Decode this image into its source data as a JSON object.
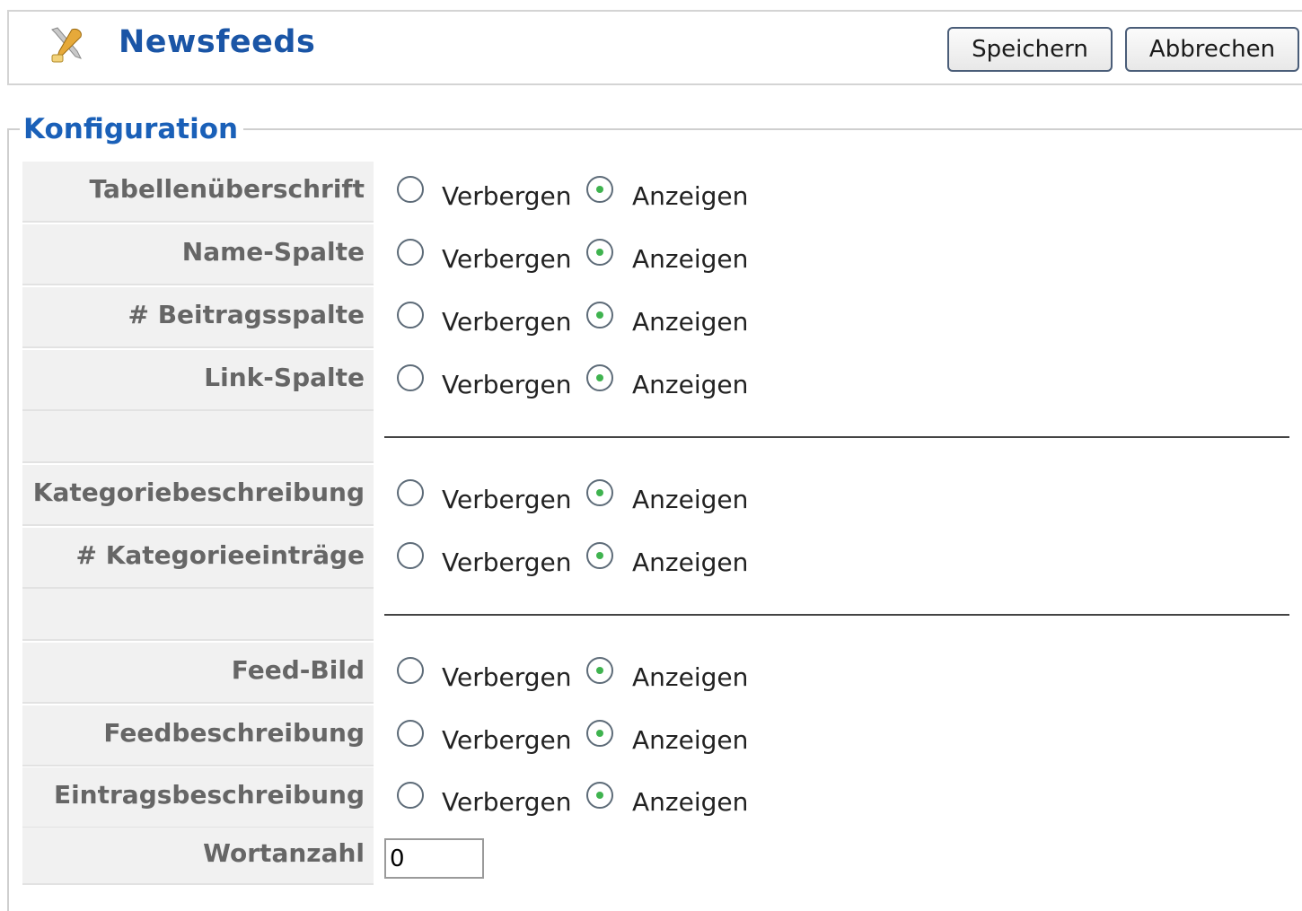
{
  "header": {
    "title": "Newsfeeds",
    "icon": "config-tools-icon",
    "save_label": "Speichern",
    "cancel_label": "Abbrechen"
  },
  "config": {
    "legend": "Konfiguration",
    "rows": [
      {
        "label": "Tabellenüberschrift",
        "options": [
          "Verbergen",
          "Anzeigen"
        ],
        "selected": "Anzeigen"
      },
      {
        "label": "Name-Spalte",
        "options": [
          "Verbergen",
          "Anzeigen"
        ],
        "selected": "Anzeigen"
      },
      {
        "label": "# Beitragsspalte",
        "options": [
          "Verbergen",
          "Anzeigen"
        ],
        "selected": "Anzeigen"
      },
      {
        "label": "Link-Spalte",
        "options": [
          "Verbergen",
          "Anzeigen"
        ],
        "selected": "Anzeigen"
      },
      {
        "label": "Kategoriebeschreibung",
        "options": [
          "Verbergen",
          "Anzeigen"
        ],
        "selected": "Anzeigen"
      },
      {
        "label": "# Kategorieeinträge",
        "options": [
          "Verbergen",
          "Anzeigen"
        ],
        "selected": "Anzeigen"
      },
      {
        "label": "Feed-Bild",
        "options": [
          "Verbergen",
          "Anzeigen"
        ],
        "selected": "Anzeigen"
      },
      {
        "label": "Feedbeschreibung",
        "options": [
          "Verbergen",
          "Anzeigen"
        ],
        "selected": "Anzeigen"
      },
      {
        "label": "Eintragsbeschreibung",
        "options": [
          "Verbergen",
          "Anzeigen"
        ],
        "selected": "Anzeigen"
      }
    ],
    "word_count": {
      "label": "Wortanzahl",
      "value": "0"
    }
  },
  "colors": {
    "title": "#1a55a6",
    "legend": "#1a60b8",
    "key_bg": "#f1f1f1",
    "radio_dot": "#3fb34f"
  }
}
